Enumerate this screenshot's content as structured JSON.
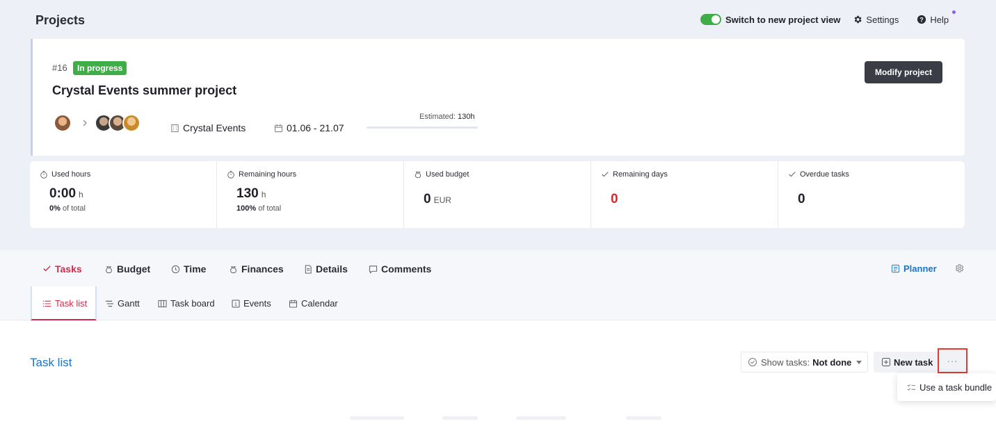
{
  "header": {
    "title": "Projects",
    "switch_label": "Switch to new project view",
    "settings_label": "Settings",
    "help_label": "Help"
  },
  "project": {
    "id": "#16",
    "status": "In progress",
    "name": "Crystal Events summer project",
    "modify_label": "Modify project",
    "client": "Crystal Events",
    "dates": "01.06 - 21.07",
    "estimated_label": "Estimated:",
    "estimated_value": "130h",
    "progress": 0.0
  },
  "stats": [
    {
      "label": "Used hours",
      "value": "0:00",
      "unit": "h",
      "sub_value": "0%",
      "sub_text": "of total"
    },
    {
      "label": "Remaining hours",
      "value": "130",
      "unit": "h",
      "sub_value": "100%",
      "sub_text": "of total"
    },
    {
      "label": "Used budget",
      "value": "0",
      "unit": "EUR"
    },
    {
      "label": "Remaining days",
      "value": "0"
    },
    {
      "label": "Overdue tasks",
      "value": "0"
    }
  ],
  "tabs": {
    "tasks": "Tasks",
    "budget": "Budget",
    "time": "Time",
    "finances": "Finances",
    "details": "Details",
    "comments": "Comments",
    "planner": "Planner"
  },
  "subtabs": {
    "task_list": "Task list",
    "gantt": "Gantt",
    "task_board": "Task board",
    "events": "Events",
    "calendar": "Calendar"
  },
  "task_section": {
    "title": "Task list",
    "show_tasks_label": "Show tasks:",
    "show_tasks_value": "Not done",
    "new_task_label": "New task",
    "more_label": "···",
    "dropdown_item": "Use a task bundle"
  },
  "colors": {
    "accent_green": "#3fae49",
    "accent_red": "#d52a4a",
    "link_blue": "#1b74c5"
  }
}
